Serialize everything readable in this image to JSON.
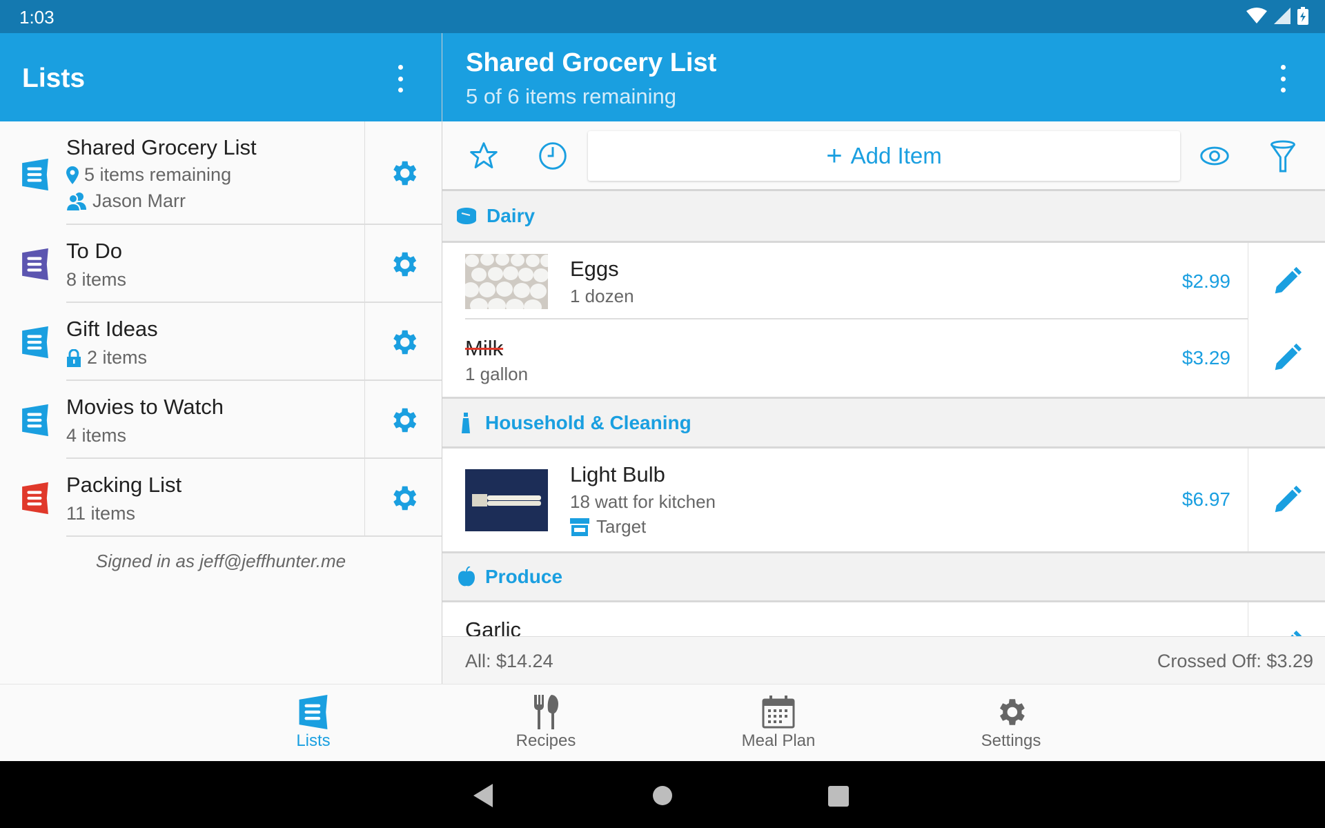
{
  "status_bar": {
    "time": "1:03",
    "icons": [
      "wifi-icon",
      "signal-icon",
      "battery-charging-icon"
    ]
  },
  "left_panel": {
    "title": "Lists",
    "lists": [
      {
        "name": "Shared Grocery List",
        "meta": "5 items remaining",
        "meta_icon": "location-pin-icon",
        "shared_with": "Jason Marr",
        "color": "#1a9fe0"
      },
      {
        "name": "To Do",
        "meta": "8 items",
        "color": "#5c55b0"
      },
      {
        "name": "Gift Ideas",
        "meta": "2 items",
        "meta_icon": "lock-icon",
        "color": "#1a9fe0"
      },
      {
        "name": "Movies to Watch",
        "meta": "4 items",
        "color": "#1a9fe0"
      },
      {
        "name": "Packing List",
        "meta": "11 items",
        "color": "#e0382a"
      }
    ],
    "signed_in": "Signed in as jeff@jeffhunter.me"
  },
  "right_panel": {
    "title": "Shared Grocery List",
    "subtitle": "5 of 6 items remaining",
    "add_item": "Add Item",
    "categories": [
      {
        "name": "Dairy",
        "icon": "dairy-icon",
        "items": [
          {
            "name": "Eggs",
            "desc": "1 dozen",
            "price": "$2.99",
            "has_photo": true,
            "crossed_off": false
          },
          {
            "name": "Milk",
            "desc": "1 gallon",
            "price": "$3.29",
            "crossed_off": true
          }
        ]
      },
      {
        "name": "Household & Cleaning",
        "icon": "spray-bottle-icon",
        "items": [
          {
            "name": "Light Bulb",
            "desc": "18 watt for kitchen",
            "store": "Target",
            "price": "$6.97",
            "has_photo": true,
            "crossed_off": false
          }
        ]
      },
      {
        "name": "Produce",
        "icon": "apple-icon",
        "items": [
          {
            "name": "Garlic"
          }
        ]
      }
    ],
    "totals": {
      "all": "All: $14.24",
      "crossed_off": "Crossed Off: $3.29"
    }
  },
  "bottom_nav": [
    {
      "label": "Lists",
      "icon": "list-icon",
      "active": true
    },
    {
      "label": "Recipes",
      "icon": "fork-knife-icon"
    },
    {
      "label": "Meal Plan",
      "icon": "calendar-icon"
    },
    {
      "label": "Settings",
      "icon": "gear-icon"
    }
  ],
  "colors": {
    "accent": "#1a9fe0",
    "status_bar": "#1479b0",
    "strike": "#e0382a"
  }
}
